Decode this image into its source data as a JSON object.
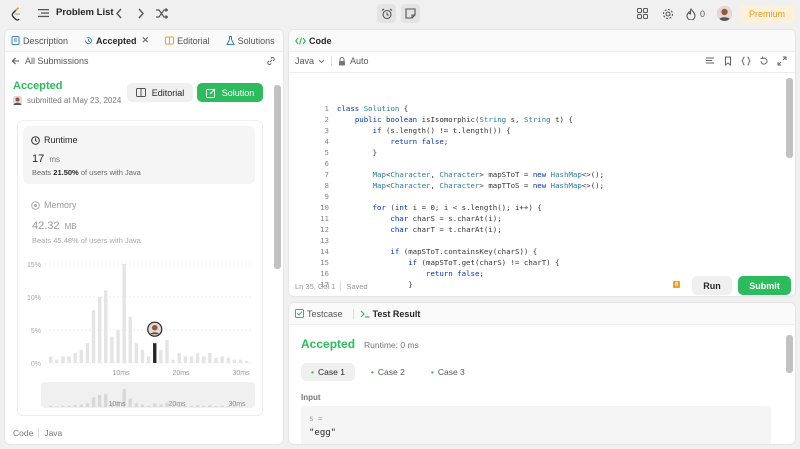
{
  "topbar": {
    "problem_list": "Problem List",
    "streak": "0",
    "premium": "Premium"
  },
  "left": {
    "tabs": {
      "description": "Description",
      "accepted": "Accepted",
      "editorial": "Editorial",
      "solutions": "Solutions"
    },
    "back": "All Submissions",
    "status": "Accepted",
    "submitted": "submitted at May 23, 2024",
    "editorial_btn": "Editorial",
    "solution_btn": "Solution",
    "runtime": {
      "label": "Runtime",
      "value": "17",
      "unit": "ms",
      "beats_prefix": "Beats",
      "beats_value": "21.50%",
      "beats_suffix": "of users with Java"
    },
    "memory": {
      "label": "Memory",
      "value": "42.32",
      "unit": "MB",
      "beats": "Beats 45.48% of users with Java"
    },
    "chart": {
      "yticks": [
        "15%",
        "10%",
        "5%",
        "0%"
      ],
      "xticks": [
        "10ms",
        "20ms",
        "30ms"
      ],
      "mini_xticks": [
        "10ms",
        "20ms",
        "30ms"
      ]
    },
    "footer": {
      "code": "Code",
      "lang": "Java"
    }
  },
  "chart_data": {
    "type": "bar",
    "ylabel": "",
    "ylim": [
      0,
      15
    ],
    "values": [
      1,
      0.5,
      1,
      1,
      1.5,
      2,
      3,
      8,
      10,
      11,
      4,
      5,
      15,
      7,
      3,
      2,
      1,
      3,
      2,
      3.5,
      0.5,
      1.5,
      1,
      1,
      1.5,
      1,
      1.5,
      0.8,
      1,
      0.8,
      0.5,
      0.5,
      0.3
    ],
    "highlight_index": 17
  },
  "editor": {
    "title": "Code",
    "lang": "Java",
    "mode": "Auto",
    "status": "Ln 35, Col 1",
    "saved": "Saved",
    "run": "Run",
    "submit": "Submit",
    "lines": [
      "class Solution {",
      "    public boolean isIsomorphic(String s, String t) {",
      "        if (s.length() != t.length()) {",
      "            return false;",
      "        }",
      "",
      "        Map<Character, Character> mapSToT = new HashMap<>();",
      "        Map<Character, Character> mapTToS = new HashMap<>();",
      "",
      "        for (int i = 0; i < s.length(); i++) {",
      "            char charS = s.charAt(i);",
      "            char charT = t.charAt(i);",
      "",
      "            if (mapSToT.containsKey(charS)) {",
      "                if (mapSToT.get(charS) != charT) {",
      "                    return false;",
      "                }"
    ]
  },
  "result": {
    "tabs": {
      "testcase": "Testcase",
      "test_result": "Test Result"
    },
    "status": "Accepted",
    "runtime": "Runtime: 0 ms",
    "cases": [
      "Case 1",
      "Case 2",
      "Case 3"
    ],
    "input_label": "Input",
    "var": "s =",
    "val": "\"egg\""
  }
}
